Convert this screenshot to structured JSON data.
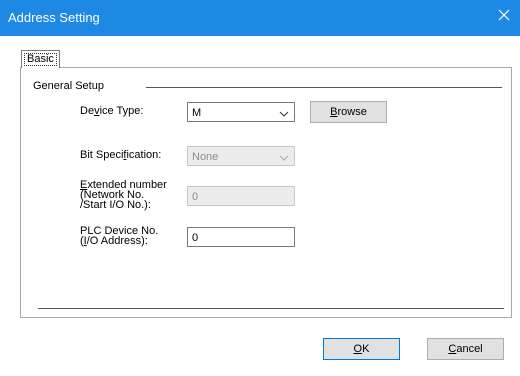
{
  "window": {
    "title": "Address Setting",
    "close_icon": "close-icon",
    "accent_color": "#1e88e5"
  },
  "tabs": [
    {
      "label": "Basic",
      "selected": true
    }
  ],
  "group": {
    "label": "General Setup"
  },
  "device_type": {
    "label_pre": "De",
    "label_u": "v",
    "label_post": "ice Type:",
    "value": "M"
  },
  "browse_button": {
    "label_u": "B",
    "label_post": "rowse"
  },
  "bit_spec": {
    "label_pre": "Bit Speci",
    "label_u": "f",
    "label_post": "ication:",
    "value": "None"
  },
  "extended": {
    "line1_u": "E",
    "line1_post": "xtended number",
    "line2": "(Network No.",
    "line3": "/Start I/O No.):",
    "value": "0"
  },
  "plc_device": {
    "line1": "PLC Device No.",
    "line2_pre": "(",
    "line2_u": "I",
    "line2_post": "/O Address):",
    "value": "0"
  },
  "ok_button": {
    "label_u": "O",
    "label_post": "K"
  },
  "cancel_button": {
    "label_u": "C",
    "label_post": "ancel"
  }
}
